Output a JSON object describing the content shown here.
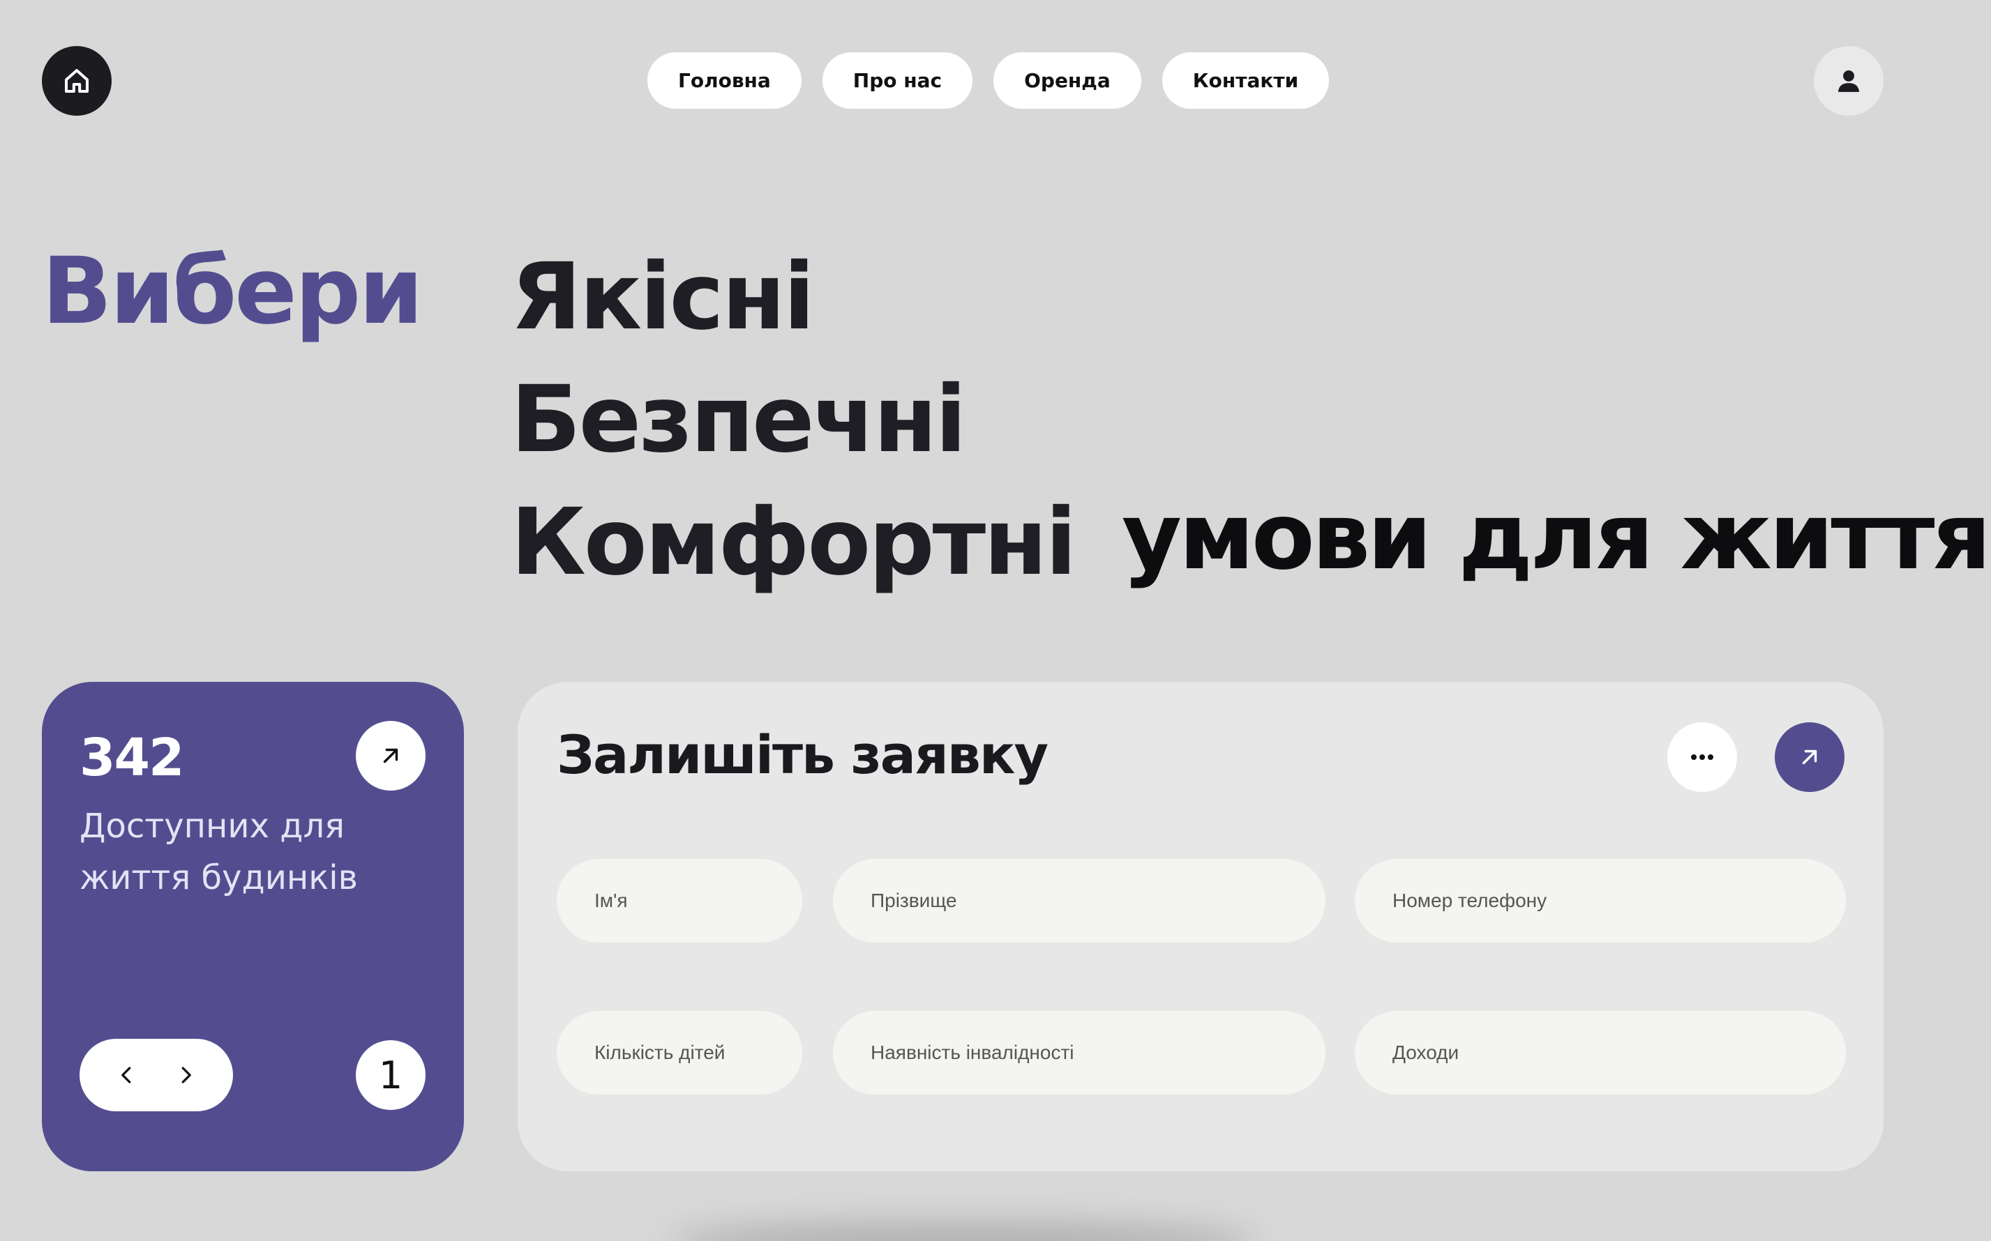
{
  "nav": {
    "items": [
      {
        "label": "Головна"
      },
      {
        "label": "Про нас"
      },
      {
        "label": "Оренда"
      },
      {
        "label": "Контакти"
      }
    ]
  },
  "icons": {
    "home": "home-icon",
    "user": "user-icon",
    "arrow": "arrow-up-right-icon",
    "more": "more-dots-icon",
    "prev": "chevron-left-icon",
    "next": "chevron-right-icon"
  },
  "hero": {
    "choose": "Вибери",
    "line1": "Якісні",
    "line2": "Безпечні",
    "line3": "Комфортні",
    "tail": "умови для життя"
  },
  "stat_card": {
    "number": "342",
    "label": "Доступних для життя будинків",
    "page": "1"
  },
  "form": {
    "title": "Залишіть заявку",
    "fields": {
      "first_name": "Ім'я",
      "last_name": "Прізвище",
      "phone": "Номер телефону",
      "children": "Кількість дітей",
      "disability": "Наявність інвалідності",
      "income": "Доходи"
    }
  },
  "colors": {
    "accent": "#534d90",
    "background": "#d8d8d8",
    "card": "#e7e7e7",
    "field": "#f4f4f0",
    "dark": "#1c1c20"
  }
}
